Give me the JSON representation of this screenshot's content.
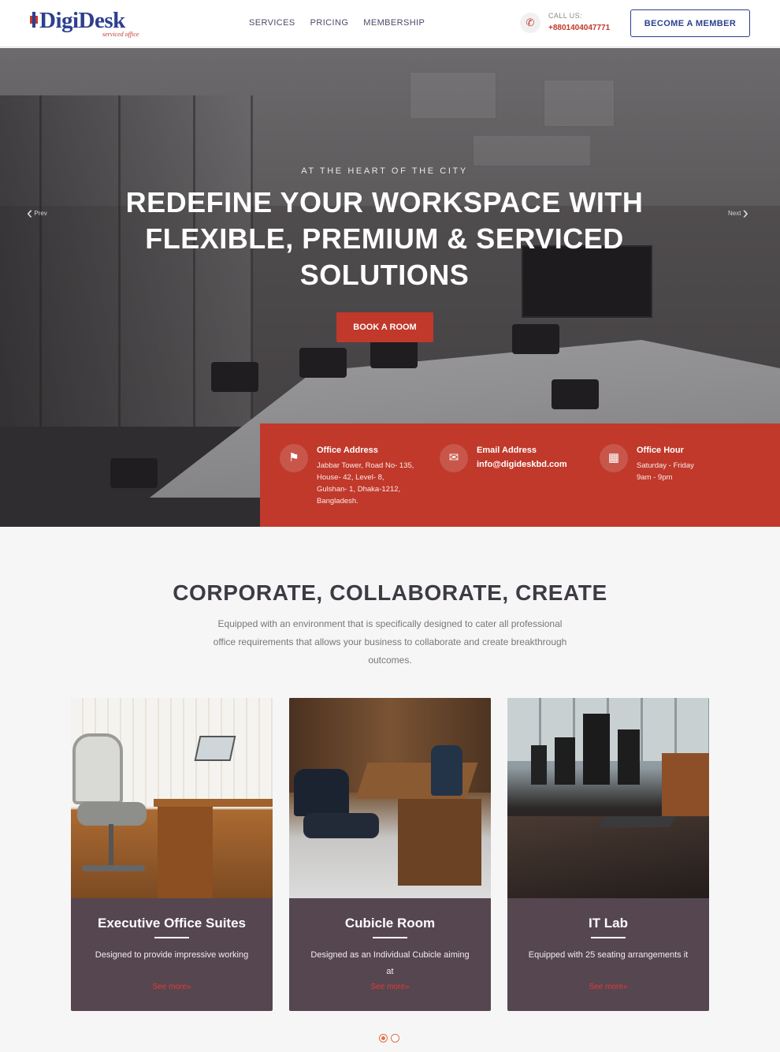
{
  "brand": {
    "name": "DigiDesk",
    "tagline": "serviced office"
  },
  "nav": {
    "items": [
      "SERVICES",
      "PRICING",
      "MEMBERSHIP"
    ]
  },
  "call": {
    "label": "CALL US:",
    "number": "+8801404047771",
    "icon": "phone-icon"
  },
  "header": {
    "cta_label": "BECOME A MEMBER"
  },
  "hero": {
    "eyebrow": "AT THE HEART OF THE CITY",
    "headline": "REDEFINE YOUR WORKSPACE WITH FLEXIBLE, PREMIUM & SERVICED SOLUTIONS",
    "cta_label": "BOOK A ROOM",
    "prev_label": "Prev",
    "next_label": "Next"
  },
  "info": {
    "address_title": "Office Address",
    "address_text": "Jabbar Tower, Road No- 135,\nHouse- 42, Level- 8,\nGulshan- 1, Dhaka-1212,\nBangladesh.",
    "email_title": "Email Address",
    "email_text": "info@digideskbd.com",
    "hours_title": "Office Hour",
    "hours_text": "Saturday - Friday\n9am - 9pm",
    "accent_color": "#c0392b"
  },
  "section": {
    "title": "CORPORATE, COLLABORATE, CREATE",
    "description": "Equipped with an environment that is specifically designed to cater all professional office requirements that allows your business to collaborate and create breakthrough outcomes."
  },
  "cards": [
    {
      "title": "Executive Office Suites",
      "description": "Designed to provide impressive working",
      "more": "See more»"
    },
    {
      "title": "Cubicle Room",
      "description": "Designed as an Individual Cubicle aiming at",
      "more": "See more»"
    },
    {
      "title": "IT Lab",
      "description": "Equipped with 25 seating arrangements it",
      "more": "See more»"
    }
  ],
  "carousel": {
    "pages": 2,
    "active": 1
  }
}
